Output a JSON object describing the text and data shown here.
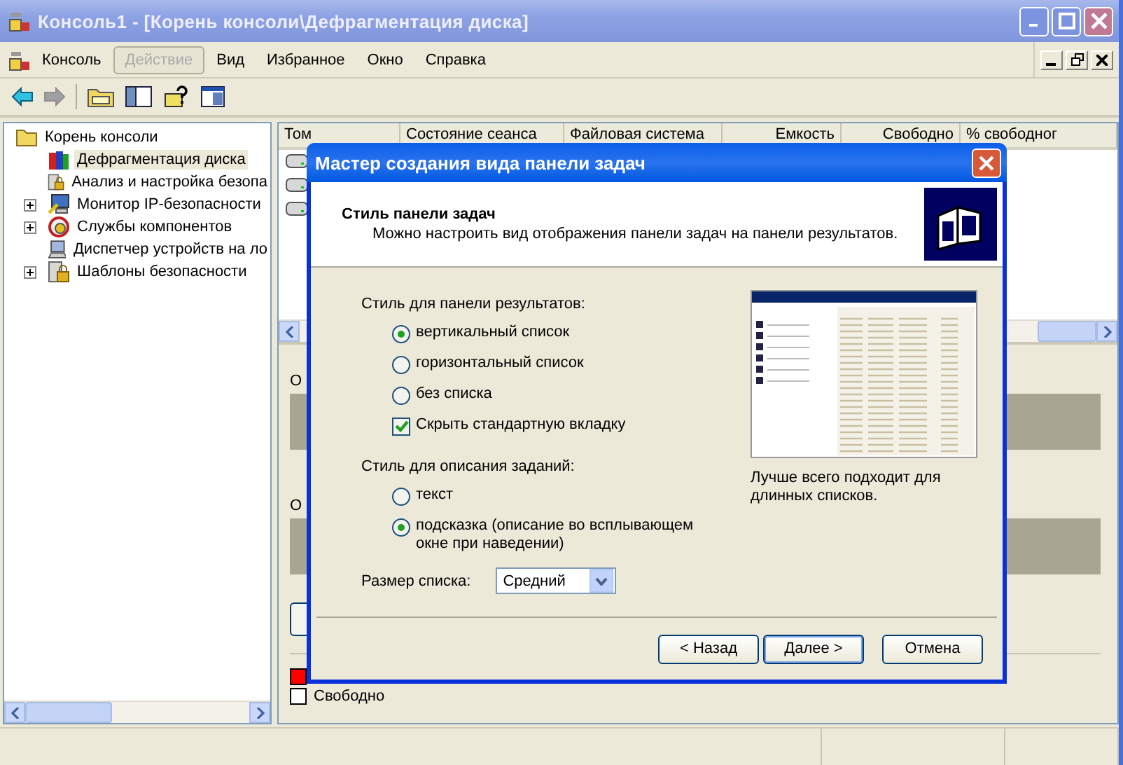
{
  "window": {
    "title": "Консоль1 - [Корень консоли\\Дефрагментация диска]"
  },
  "menu": [
    {
      "label": "Консоль",
      "selected": false
    },
    {
      "label": "Действие",
      "selected": true
    },
    {
      "label": "Вид",
      "selected": false
    },
    {
      "label": "Избранное",
      "selected": false
    },
    {
      "label": "Окно",
      "selected": false
    },
    {
      "label": "Справка",
      "selected": false
    }
  ],
  "toolbar": [
    {
      "kind": "back",
      "disabled": false
    },
    {
      "kind": "forward",
      "disabled": true
    },
    {
      "kind": "sep"
    },
    {
      "kind": "folder"
    },
    {
      "kind": "pane"
    },
    {
      "kind": "help"
    },
    {
      "kind": "window"
    }
  ],
  "tree": {
    "label": "Корень консоли",
    "children": [
      {
        "label": "Дефрагментация диска",
        "selected": true,
        "expandable": false,
        "kind": "defrag"
      },
      {
        "label": "Анализ и настройка безопа",
        "selected": false,
        "expandable": false,
        "kind": "lock"
      },
      {
        "label": "Монитор IP-безопасности",
        "selected": false,
        "expandable": true,
        "kind": "monitor"
      },
      {
        "label": "Службы компонентов",
        "selected": false,
        "expandable": true,
        "kind": "gear"
      },
      {
        "label": "Диспетчер устройств на ло",
        "selected": false,
        "expandable": false,
        "kind": "computer"
      },
      {
        "label": "Шаблоны безопасности",
        "selected": false,
        "expandable": true,
        "kind": "lock"
      }
    ]
  },
  "table": {
    "columns": [
      "Том",
      "Состояние сеанса",
      "Файловая система",
      "Емкость",
      "Свободно",
      "% свободног"
    ],
    "rows": [
      {
        "kind": "disk"
      },
      {
        "kind": "disk"
      },
      {
        "kind": "disk"
      }
    ]
  },
  "lower_pane": {
    "labels": [
      "О",
      "О"
    ],
    "legend": [
      {
        "color": "#ff0000"
      },
      {
        "color": "#ffffff",
        "label": "Свободно"
      }
    ]
  },
  "dialog": {
    "title": "Мастер создания вида панели задач",
    "heading": "Стиль панели задач",
    "subheading": "Можно настроить вид отображения панели задач на панели результатов.",
    "group_1": {
      "label": "Стиль для панели результатов:",
      "options": [
        {
          "kind": "radio",
          "label": "вертикальный список",
          "selected": true
        },
        {
          "kind": "radio",
          "label": "горизонтальный список",
          "selected": false
        },
        {
          "kind": "radio",
          "label": "без списка",
          "selected": false
        },
        {
          "kind": "checkbox",
          "label": "Скрыть стандартную вкладку",
          "checked": true
        }
      ]
    },
    "group_2": {
      "label": "Стиль для описания заданий:",
      "options": [
        {
          "kind": "radio",
          "label": "текст",
          "selected": false
        },
        {
          "kind": "radio",
          "label": "подсказка (описание во всплывающем окне при наведении)",
          "selected": true
        }
      ]
    },
    "size": {
      "label": "Размер списка:",
      "value": "Средний"
    },
    "preview_caption": "Лучше всего подходит для длинных списков.",
    "buttons": [
      {
        "label": "< Назад",
        "default": false
      },
      {
        "label": "Далее >",
        "default": true
      },
      {
        "label": "Отмена",
        "default": false
      }
    ]
  }
}
